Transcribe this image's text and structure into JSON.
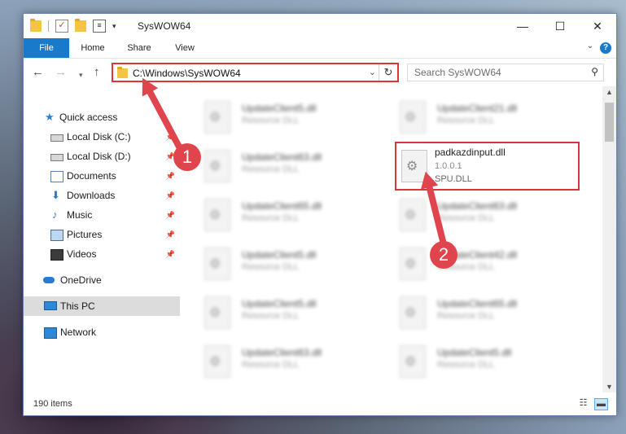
{
  "window": {
    "title": "SysWOW64",
    "controls": {
      "minimize": "—",
      "maximize": "☐",
      "close": "✕"
    }
  },
  "ribbon": {
    "tabs": [
      "File",
      "Home",
      "Share",
      "View"
    ],
    "help": "?"
  },
  "address": {
    "path": "C:\\Windows\\SysWOW64",
    "refresh": "↻",
    "dropdown": "⌄"
  },
  "search": {
    "placeholder": "Search SysWOW64"
  },
  "sidebar": {
    "items": [
      {
        "label": "Quick access",
        "icon": "star-icon"
      },
      {
        "label": "Local Disk (C:)",
        "icon": "disk-icon"
      },
      {
        "label": "Local Disk (D:)",
        "icon": "disk-icon"
      },
      {
        "label": "Documents",
        "icon": "documents-icon"
      },
      {
        "label": "Downloads",
        "icon": "downloads-icon"
      },
      {
        "label": "Music",
        "icon": "music-icon"
      },
      {
        "label": "Pictures",
        "icon": "pictures-icon"
      },
      {
        "label": "Videos",
        "icon": "videos-icon"
      },
      {
        "label": "OneDrive",
        "icon": "cloud-icon"
      },
      {
        "label": "This PC",
        "icon": "computer-icon"
      },
      {
        "label": "Network",
        "icon": "network-icon"
      }
    ]
  },
  "files": {
    "left": [
      {
        "name": "UpdateClient5.dll",
        "desc": "Resource DLL"
      },
      {
        "name": "UpdateClient63.dll",
        "desc": "Resource DLL"
      },
      {
        "name": "UpdateClient65.dll",
        "desc": "Resource DLL"
      },
      {
        "name": "UpdateClient5.dll",
        "desc": "Resource DLL"
      },
      {
        "name": "UpdateClient5.dll",
        "desc": "Resource DLL"
      },
      {
        "name": "UpdateClient63.dll",
        "desc": "Resource DLL"
      }
    ],
    "right": [
      {
        "name": "UpdateClient21.dll",
        "desc": "Resource DLL"
      },
      {
        "name": "padkazdinput.dll",
        "version": "1.0.0.1",
        "desc": "SPU.DLL"
      },
      {
        "name": "UpdateClient63.dll",
        "desc": "Resource DLL"
      },
      {
        "name": "UpdateClient42.dll",
        "desc": "Resource DLL"
      },
      {
        "name": "UpdateClient65.dll",
        "desc": "Resource DLL"
      },
      {
        "name": "UpdateClient5.dll",
        "desc": "Resource DLL"
      }
    ]
  },
  "status": {
    "count": "190 items"
  },
  "annotations": {
    "badge1": "1",
    "badge2": "2"
  },
  "colors": {
    "accent": "#1979ca",
    "annotation": "#e0454e",
    "highlight_border": "#d9353b"
  }
}
